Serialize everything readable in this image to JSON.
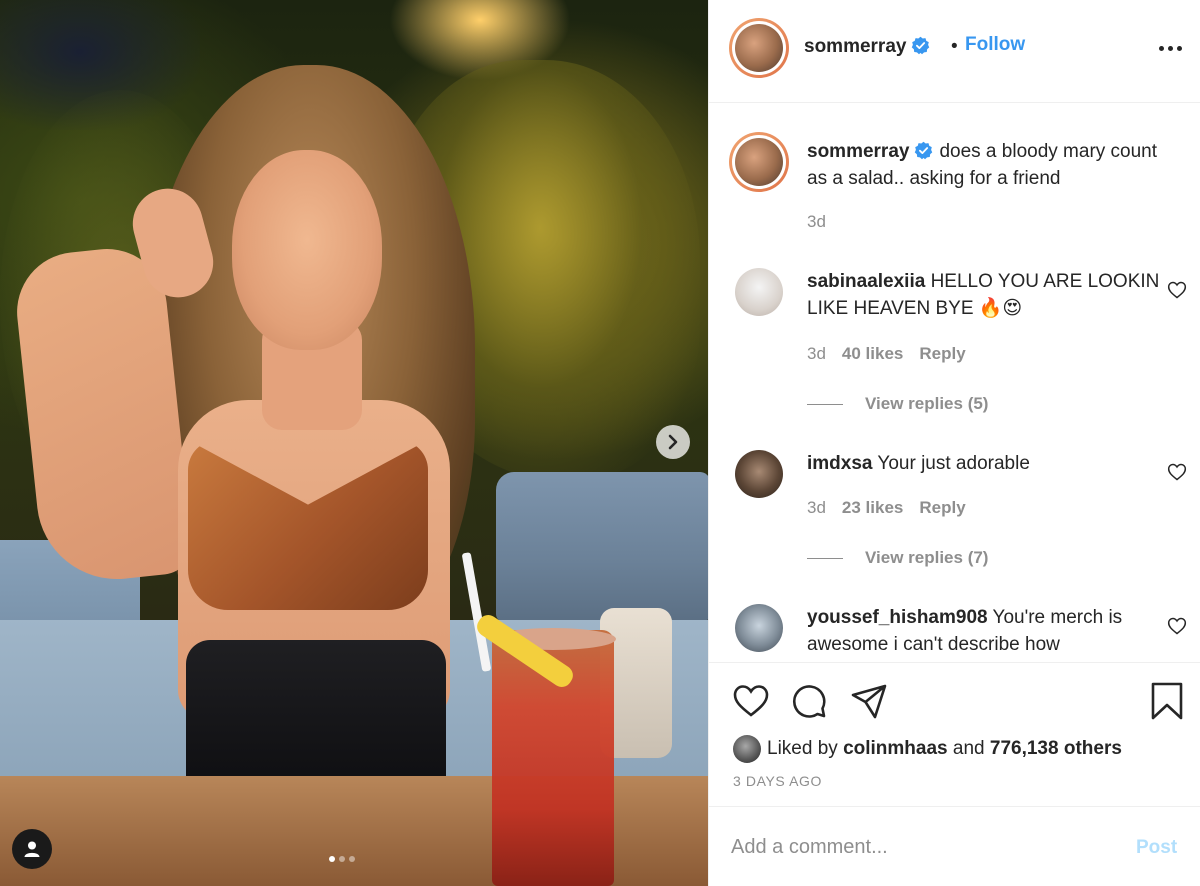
{
  "post": {
    "image_dots": 3,
    "active_dot": 0
  },
  "header": {
    "username": "sommerray",
    "separator": "•",
    "follow_label": "Follow"
  },
  "caption": {
    "username": "sommerray",
    "text": "does a bloody mary count as a salad.. asking for a friend",
    "time": "3d"
  },
  "comments": [
    {
      "username": "sabinaalexiia",
      "text": "HELLO YOU ARE LOOKIN LIKE HEAVEN BYE 🔥😍",
      "time": "3d",
      "likes": "40 likes",
      "reply_label": "Reply",
      "view_replies": "View replies (5)"
    },
    {
      "username": "imdxsa",
      "text": "Your just adorable",
      "time": "3d",
      "likes": "23 likes",
      "reply_label": "Reply",
      "view_replies": "View replies (7)"
    },
    {
      "username": "youssef_hisham908",
      "text": "You're merch is awesome i can't describe how"
    }
  ],
  "actions": {
    "liked_prefix": "Liked by",
    "liked_user": "colinmhaas",
    "liked_and": "and",
    "liked_count": "776,138 others",
    "timestamp": "3 DAYS AGO"
  },
  "add_comment": {
    "placeholder": "Add a comment...",
    "post_label": "Post"
  },
  "colors": {
    "accent": "#3897f0",
    "post_disabled": "#b2dffc",
    "muted": "#8e8e8e",
    "text": "#262626"
  },
  "icons": [
    "chevron-right-icon",
    "user-tag-icon",
    "verified-badge-icon",
    "more-icon",
    "heart-icon",
    "comment-icon",
    "share-icon",
    "bookmark-icon"
  ]
}
